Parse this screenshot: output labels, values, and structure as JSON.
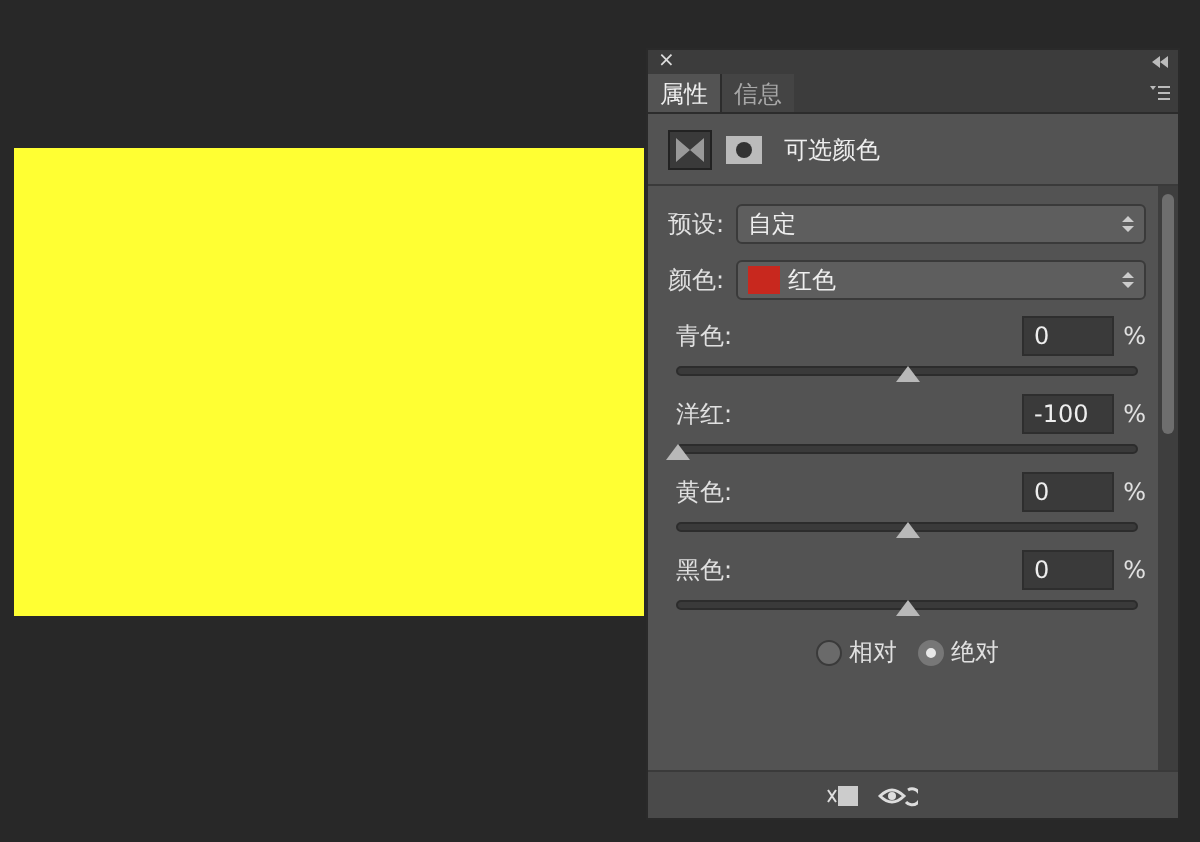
{
  "panel": {
    "close": "×",
    "tabs": [
      {
        "label": "属性",
        "selected": true
      },
      {
        "label": "信息",
        "selected": false
      }
    ],
    "title": "可选颜色",
    "preset": {
      "label": "预设:",
      "value": "自定"
    },
    "colors": {
      "label": "颜色:",
      "value": "红色",
      "color": "#c8281e"
    },
    "channels": [
      {
        "name": "青色:",
        "value": "0",
        "unit": "%",
        "level": 0.5
      },
      {
        "name": "洋红:",
        "value": "-100",
        "unit": "%",
        "level": 0
      },
      {
        "name": "黄色:",
        "value": "0",
        "unit": "%",
        "level": 0.5
      },
      {
        "name": "黑色:",
        "value": "0",
        "unit": "%",
        "level": 0.5
      }
    ],
    "modes": [
      {
        "label": "相对",
        "selected": false
      },
      {
        "label": "绝对",
        "selected": true
      }
    ]
  }
}
